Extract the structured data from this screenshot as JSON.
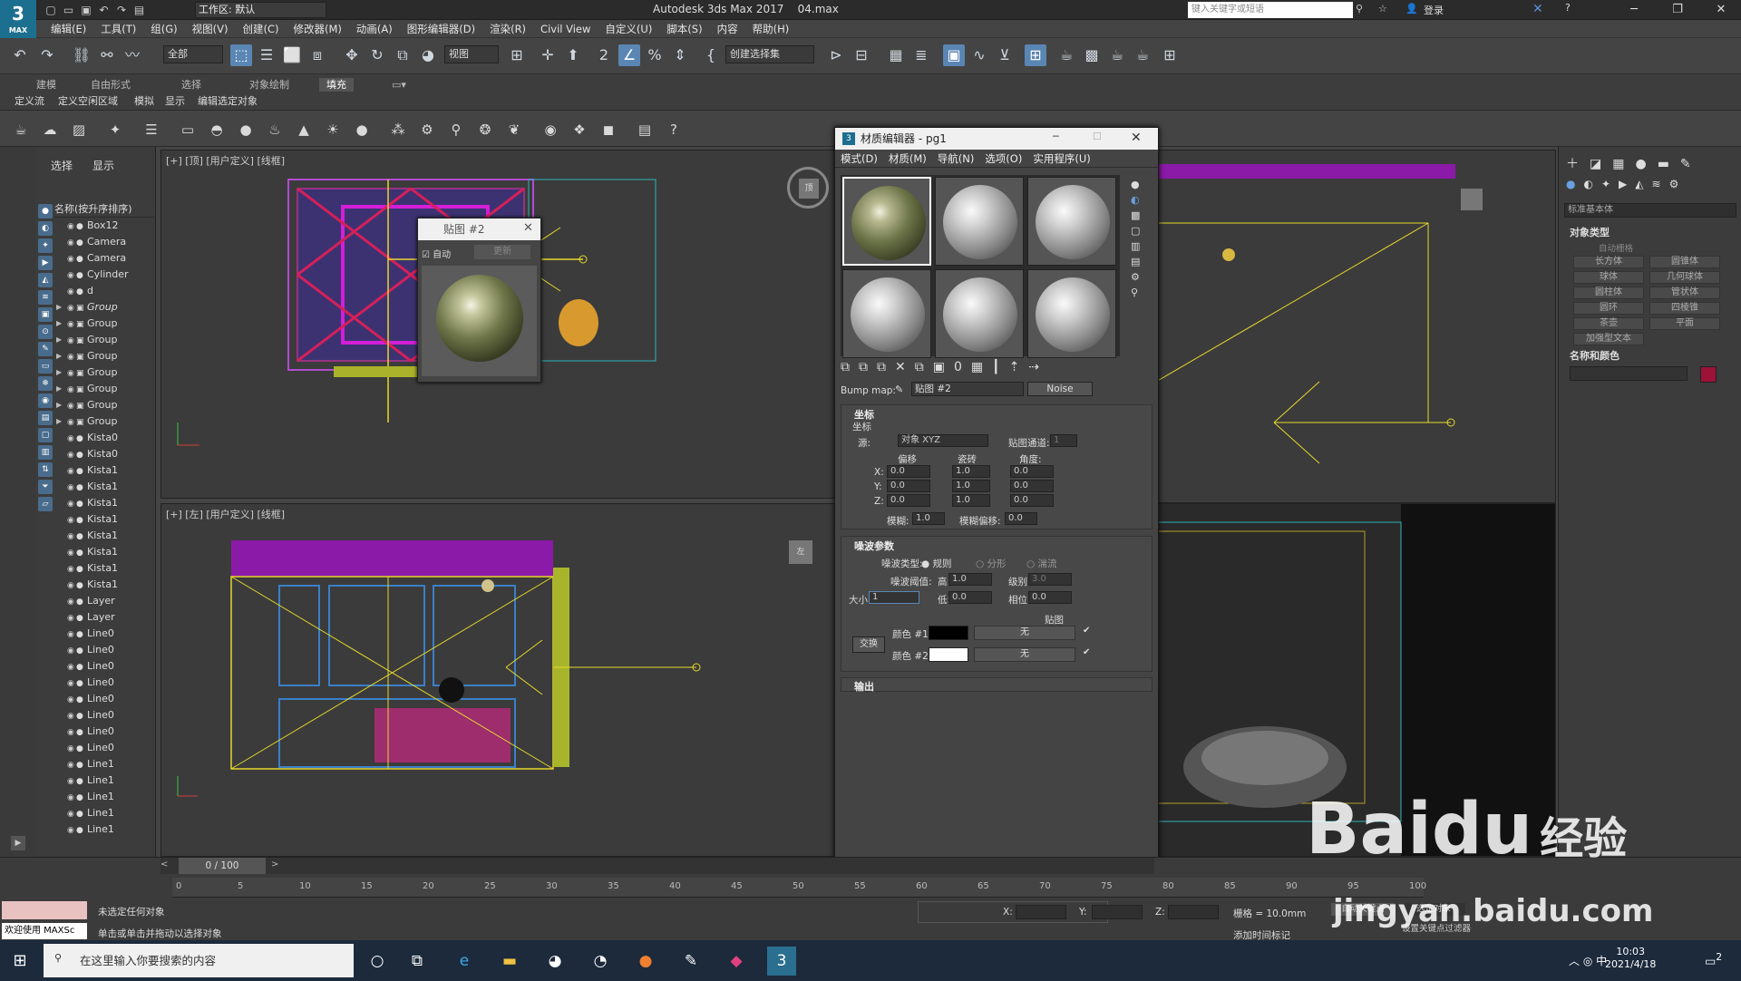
{
  "titlebar": {
    "logo": "3",
    "logo_sub": "MAX",
    "workspace": "工作区: 默认",
    "app_title": "Autodesk 3ds Max 2017",
    "file_name": "04.max",
    "search_placeholder": "键入关键字或短语",
    "login": "登录"
  },
  "menubar": [
    "编辑(E)",
    "工具(T)",
    "组(G)",
    "视图(V)",
    "创建(C)",
    "修改器(M)",
    "动画(A)",
    "图形编辑器(D)",
    "渲染(R)",
    "Civil View",
    "自定义(U)",
    "脚本(S)",
    "内容",
    "帮助(H)"
  ],
  "maintoolbar": {
    "filter": "全部",
    "refcoord": "视图",
    "selection_set": "创建选择集"
  },
  "ribbon": {
    "tabs": [
      "建模",
      "自由形式",
      "选择",
      "对象绘制",
      "填充"
    ],
    "active_tab": "填充",
    "subitems": [
      "定义流",
      "定义空闲区域",
      "模拟",
      "显示",
      "编辑选定对象"
    ]
  },
  "scene_explorer": {
    "tabs": [
      "选择",
      "显示"
    ],
    "header": "名称(按升序排序)",
    "items": [
      {
        "name": "Box12",
        "group": false
      },
      {
        "name": "Camera",
        "group": false
      },
      {
        "name": "Camera",
        "group": false
      },
      {
        "name": "Cylinder",
        "group": false
      },
      {
        "name": "d",
        "group": false
      },
      {
        "name": "Group",
        "group": true,
        "italic": true
      },
      {
        "name": "Group",
        "group": true
      },
      {
        "name": "Group",
        "group": true
      },
      {
        "name": "Group",
        "group": true
      },
      {
        "name": "Group",
        "group": true
      },
      {
        "name": "Group",
        "group": true
      },
      {
        "name": "Group",
        "group": true
      },
      {
        "name": "Group",
        "group": true
      },
      {
        "name": "Kista0",
        "group": false
      },
      {
        "name": "Kista0",
        "group": false
      },
      {
        "name": "Kista1",
        "group": false
      },
      {
        "name": "Kista1",
        "group": false
      },
      {
        "name": "Kista1",
        "group": false
      },
      {
        "name": "Kista1",
        "group": false
      },
      {
        "name": "Kista1",
        "group": false
      },
      {
        "name": "Kista1",
        "group": false
      },
      {
        "name": "Kista1",
        "group": false
      },
      {
        "name": "Kista1",
        "group": false
      },
      {
        "name": "Layer",
        "group": false
      },
      {
        "name": "Layer",
        "group": false
      },
      {
        "name": "Line0",
        "group": false
      },
      {
        "name": "Line0",
        "group": false
      },
      {
        "name": "Line0",
        "group": false
      },
      {
        "name": "Line0",
        "group": false
      },
      {
        "name": "Line0",
        "group": false
      },
      {
        "name": "Line0",
        "group": false
      },
      {
        "name": "Line0",
        "group": false
      },
      {
        "name": "Line0",
        "group": false
      },
      {
        "name": "Line1",
        "group": false
      },
      {
        "name": "Line1",
        "group": false
      },
      {
        "name": "Line1",
        "group": false
      },
      {
        "name": "Line1",
        "group": false
      },
      {
        "name": "Line1",
        "group": false
      }
    ]
  },
  "viewports": {
    "top_label": "[+] [顶] [用户定义] [线框]",
    "left_label": "[+] [左] [用户定义] [线框]",
    "cube_top": "顶",
    "cube_left": "左"
  },
  "map_window": {
    "title": "贴图 #2",
    "auto_label": "自动",
    "update_label": "更新"
  },
  "material_editor": {
    "title": "材质编辑器 - pg1",
    "menu": [
      "模式(D)",
      "材质(M)",
      "导航(N)",
      "选项(O)",
      "实用程序(U)"
    ],
    "bump_label": "Bump map:",
    "map_name": "贴图 #2",
    "map_type": "Noise",
    "coords": {
      "header": "坐标",
      "sub": "坐标",
      "source_label": "源:",
      "source_value": "对象 XYZ",
      "channel_label": "贴图通道:",
      "channel_value": "1",
      "offset": "偏移",
      "tiling": "瓷砖",
      "angle": "角度:",
      "x": "X:",
      "y": "Y:",
      "z": "Z:",
      "offset_vals": [
        "0.0",
        "0.0",
        "0.0"
      ],
      "tiling_vals": [
        "1.0",
        "1.0",
        "1.0"
      ],
      "angle_vals": [
        "0.0",
        "0.0",
        "0.0"
      ],
      "blur_label": "模糊:",
      "blur_value": "1.0",
      "blur_offset_label": "模糊偏移:",
      "blur_offset_value": "0.0"
    },
    "noise": {
      "header": "噪波参数",
      "type_label": "噪波类型:",
      "types": [
        "规则",
        "分形",
        "湍流"
      ],
      "selected_type": "规则",
      "threshold_label": "噪波阈值:",
      "high_label": "高:",
      "high_value": "1.0",
      "levels_label": "级别:",
      "levels_value": "3.0",
      "size_label": "大小:",
      "size_value": "1",
      "low_label": "低:",
      "low_value": "0.0",
      "phase_label": "相位:",
      "phase_value": "0.0",
      "maps_label": "贴图",
      "swap_label": "交换",
      "color1_label": "颜色 #1",
      "color2_label": "颜色 #2",
      "color1": "#000000",
      "color2": "#ffffff",
      "none1": "无",
      "none2": "无"
    },
    "output_header": "输出"
  },
  "command_panel": {
    "category": "标准基本体",
    "object_type_header": "对象类型",
    "autogrid": "自动栅格",
    "buttons": [
      "长方体",
      "圆锥体",
      "球体",
      "几何球体",
      "圆柱体",
      "管状体",
      "圆环",
      "四棱锥",
      "茶壶",
      "平面",
      "加强型文本"
    ],
    "name_color_header": "名称和颜色",
    "object_color": "#9c1239"
  },
  "bottom": {
    "time_slider": "0 / 100",
    "frame_ticks": [
      "0",
      "5",
      "10",
      "15",
      "20",
      "25",
      "30",
      "35",
      "40",
      "45",
      "50",
      "55",
      "60",
      "65",
      "70",
      "75",
      "80",
      "85",
      "90",
      "95",
      "100"
    ],
    "status1": "未选定任何对象",
    "status2": "单击或单击并拖动以选择对象",
    "welcome": "欢迎使用 MAXSc",
    "x_label": "X:",
    "y_label": "Y:",
    "z_label": "Z:",
    "grid": "栅格 = 10.0mm",
    "add_time_tag": "添加时间标记",
    "auto_key": "自动关键点",
    "selected": "选定对象",
    "set_key": "设置关键点过滤器"
  },
  "taskbar": {
    "search_placeholder": "在这里输入你要搜索的内容",
    "time": "10:03",
    "date": "2021/4/18",
    "ime": "中",
    "notif_count": "2"
  },
  "watermark": {
    "brand": "Baidu",
    "sub": "jingyan.baidu.com",
    "cn": "经验"
  }
}
